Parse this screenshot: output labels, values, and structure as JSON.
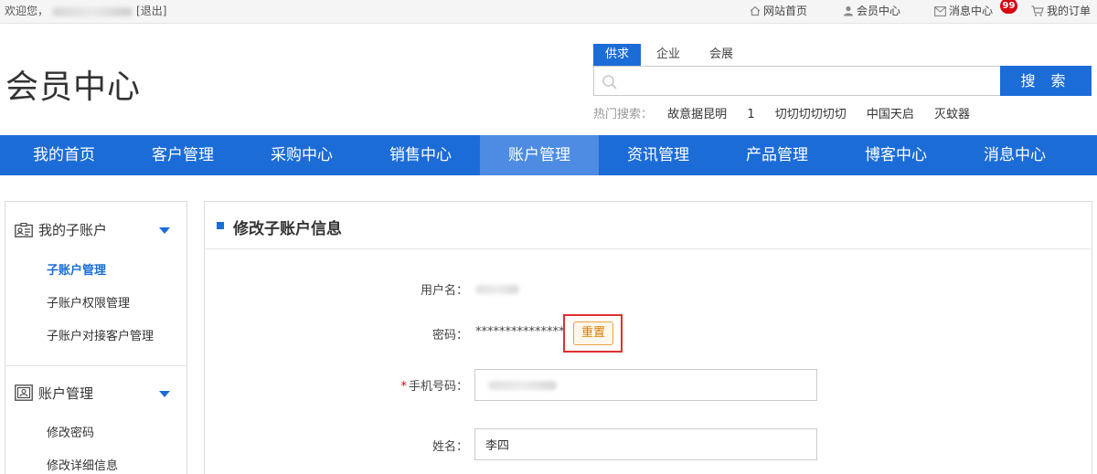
{
  "topbar": {
    "welcome": "欢迎您，",
    "logout": "[退出]",
    "links": {
      "home": "网站首页",
      "member": "会员中心",
      "messages": "消息中心",
      "message_badge": "99",
      "orders": "我的订单"
    }
  },
  "header": {
    "logo": "会员中心",
    "search_tabs": [
      "供求",
      "企业",
      "会展"
    ],
    "search_placeholder": "",
    "search_button": "搜 索",
    "hot_label": "热门搜索：",
    "hot_keywords": [
      "故意据昆明",
      "1",
      "切切切切切切",
      "中国天启",
      "灭蚊器"
    ]
  },
  "nav": [
    "我的首页",
    "客户管理",
    "采购中心",
    "销售中心",
    "账户管理",
    "资讯管理",
    "产品管理",
    "博客中心",
    "消息中心"
  ],
  "sidebar": {
    "group1": {
      "title": "我的子账户",
      "items": [
        "子账户管理",
        "子账户权限管理",
        "子账户对接客户管理"
      ]
    },
    "group2": {
      "title": "账户管理",
      "items": [
        "修改密码",
        "修改详细信息"
      ]
    }
  },
  "main": {
    "title": "修改子账户信息",
    "username_label": "用户名：",
    "password_label": "密码：",
    "password_value": "***************",
    "reset_button": "重置",
    "phone_label": "手机号码：",
    "phone_required_mark": "*",
    "name_label": "姓名：",
    "name_value": "李四"
  },
  "colors": {
    "primary": "#1c6cd8",
    "nav_active": "#4d8ce2",
    "highlight_box": "#e03030",
    "reset_text": "#e07b00",
    "badge": "#d6000f"
  }
}
